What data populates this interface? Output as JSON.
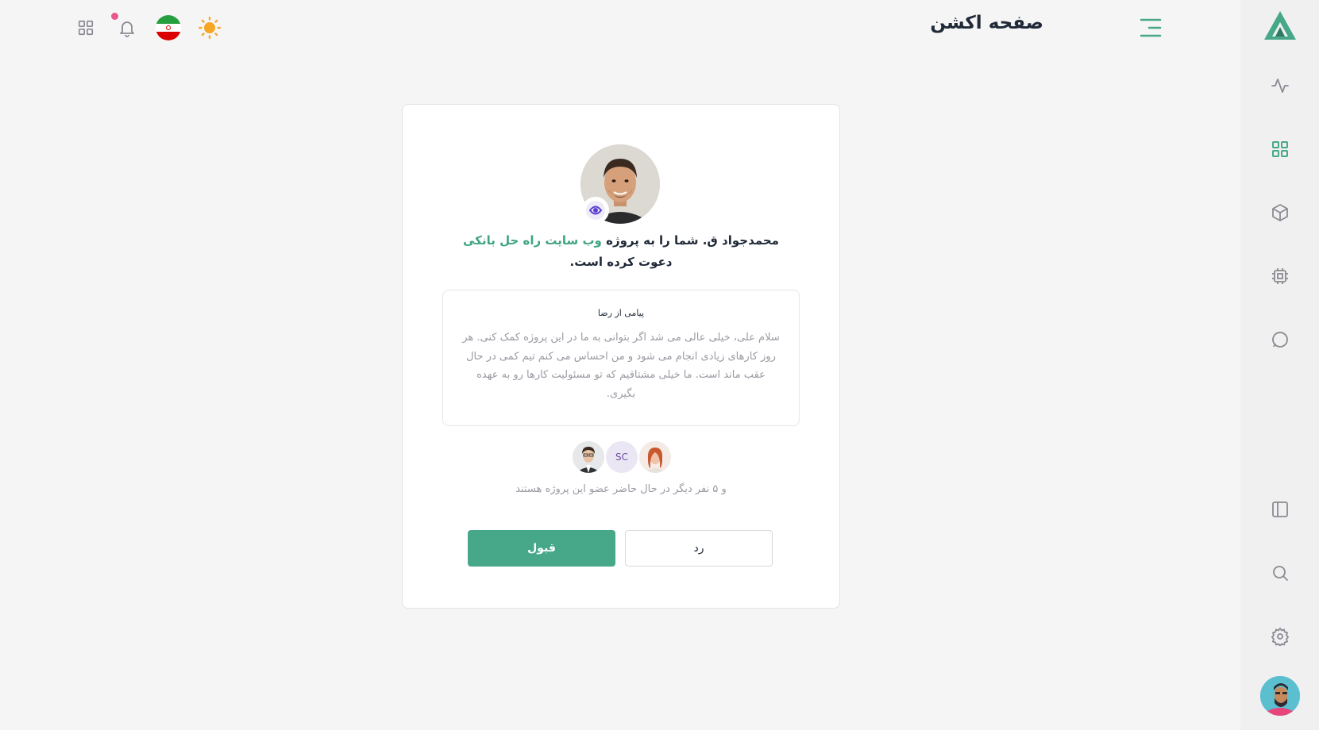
{
  "header": {
    "title": "صفحه اکشن"
  },
  "invite": {
    "inviter": "محمدجواد ق.",
    "text_before": "شما را به پروژه",
    "project_name": "وب سایت راه حل بانکی",
    "text_after": "دعوت کرده است."
  },
  "message": {
    "title": "پیامی از رضا",
    "body": "سلام علی، خیلی عالی می شد اگر بتوانی به ما در این پروژه کمک کنی. هر روز کارهای زیادی انجام می شود و من احساس می کنم تیم کمی در حال عقب ماند است. ما خیلی مشتاقیم که تو مسئولیت کارها رو به عهده بگیری."
  },
  "members": {
    "initials": "SC",
    "summary": "و ۵ نفر دیگر در حال حاضر عضو این پروژه هستند"
  },
  "actions": {
    "accept_label": "قبول",
    "reject_label": "رد"
  },
  "colors": {
    "accent": "#46a888",
    "background": "#f5f5f6",
    "sidebar": "#f0f0f1",
    "notification_dot": "#e8578d",
    "sun": "#f5a623"
  }
}
